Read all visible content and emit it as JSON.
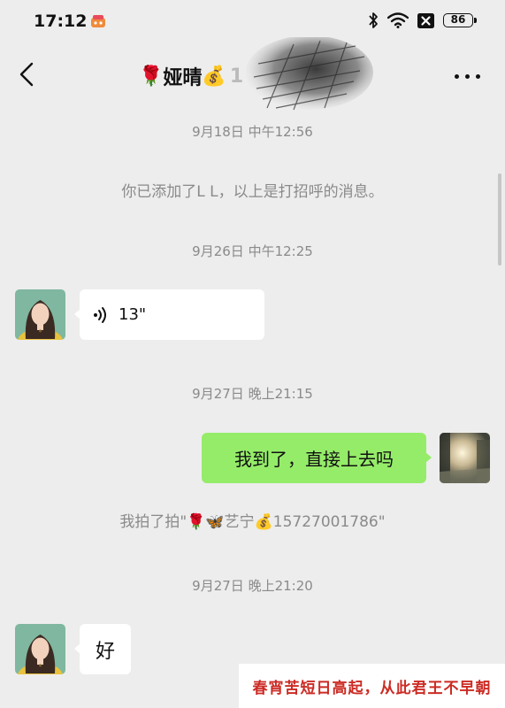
{
  "status_bar": {
    "time": "17:12",
    "battery": "86"
  },
  "header": {
    "emoji_left": "🌹",
    "title": "娅晴",
    "emoji_right": "💰",
    "trail": "1"
  },
  "messages": {
    "ts1": "9月18日 中午12:56",
    "system1": "你已添加了L L，以上是打招呼的消息。",
    "ts2": "9月26日 中午12:25",
    "voice_duration": "13\"",
    "ts3": "9月27日 晚上21:15",
    "outgoing_text": "我到了，直接上去吗",
    "pat_prefix": "我拍了拍\"",
    "pat_emoji1": "🌹",
    "pat_emoji2": "🦋",
    "pat_name": "艺宁",
    "pat_emoji3": "💰",
    "pat_suffix": "15727001786\"",
    "ts4": "9月27日 晚上21:20",
    "incoming_text": "好"
  },
  "watermark": {
    "text": "春宵苦短日高起，从此君王不早朝"
  },
  "colors": {
    "background": "#ededed",
    "outgoing_bubble": "#95ec69",
    "incoming_bubble": "#ffffff",
    "watermark": "#cc2b24"
  }
}
